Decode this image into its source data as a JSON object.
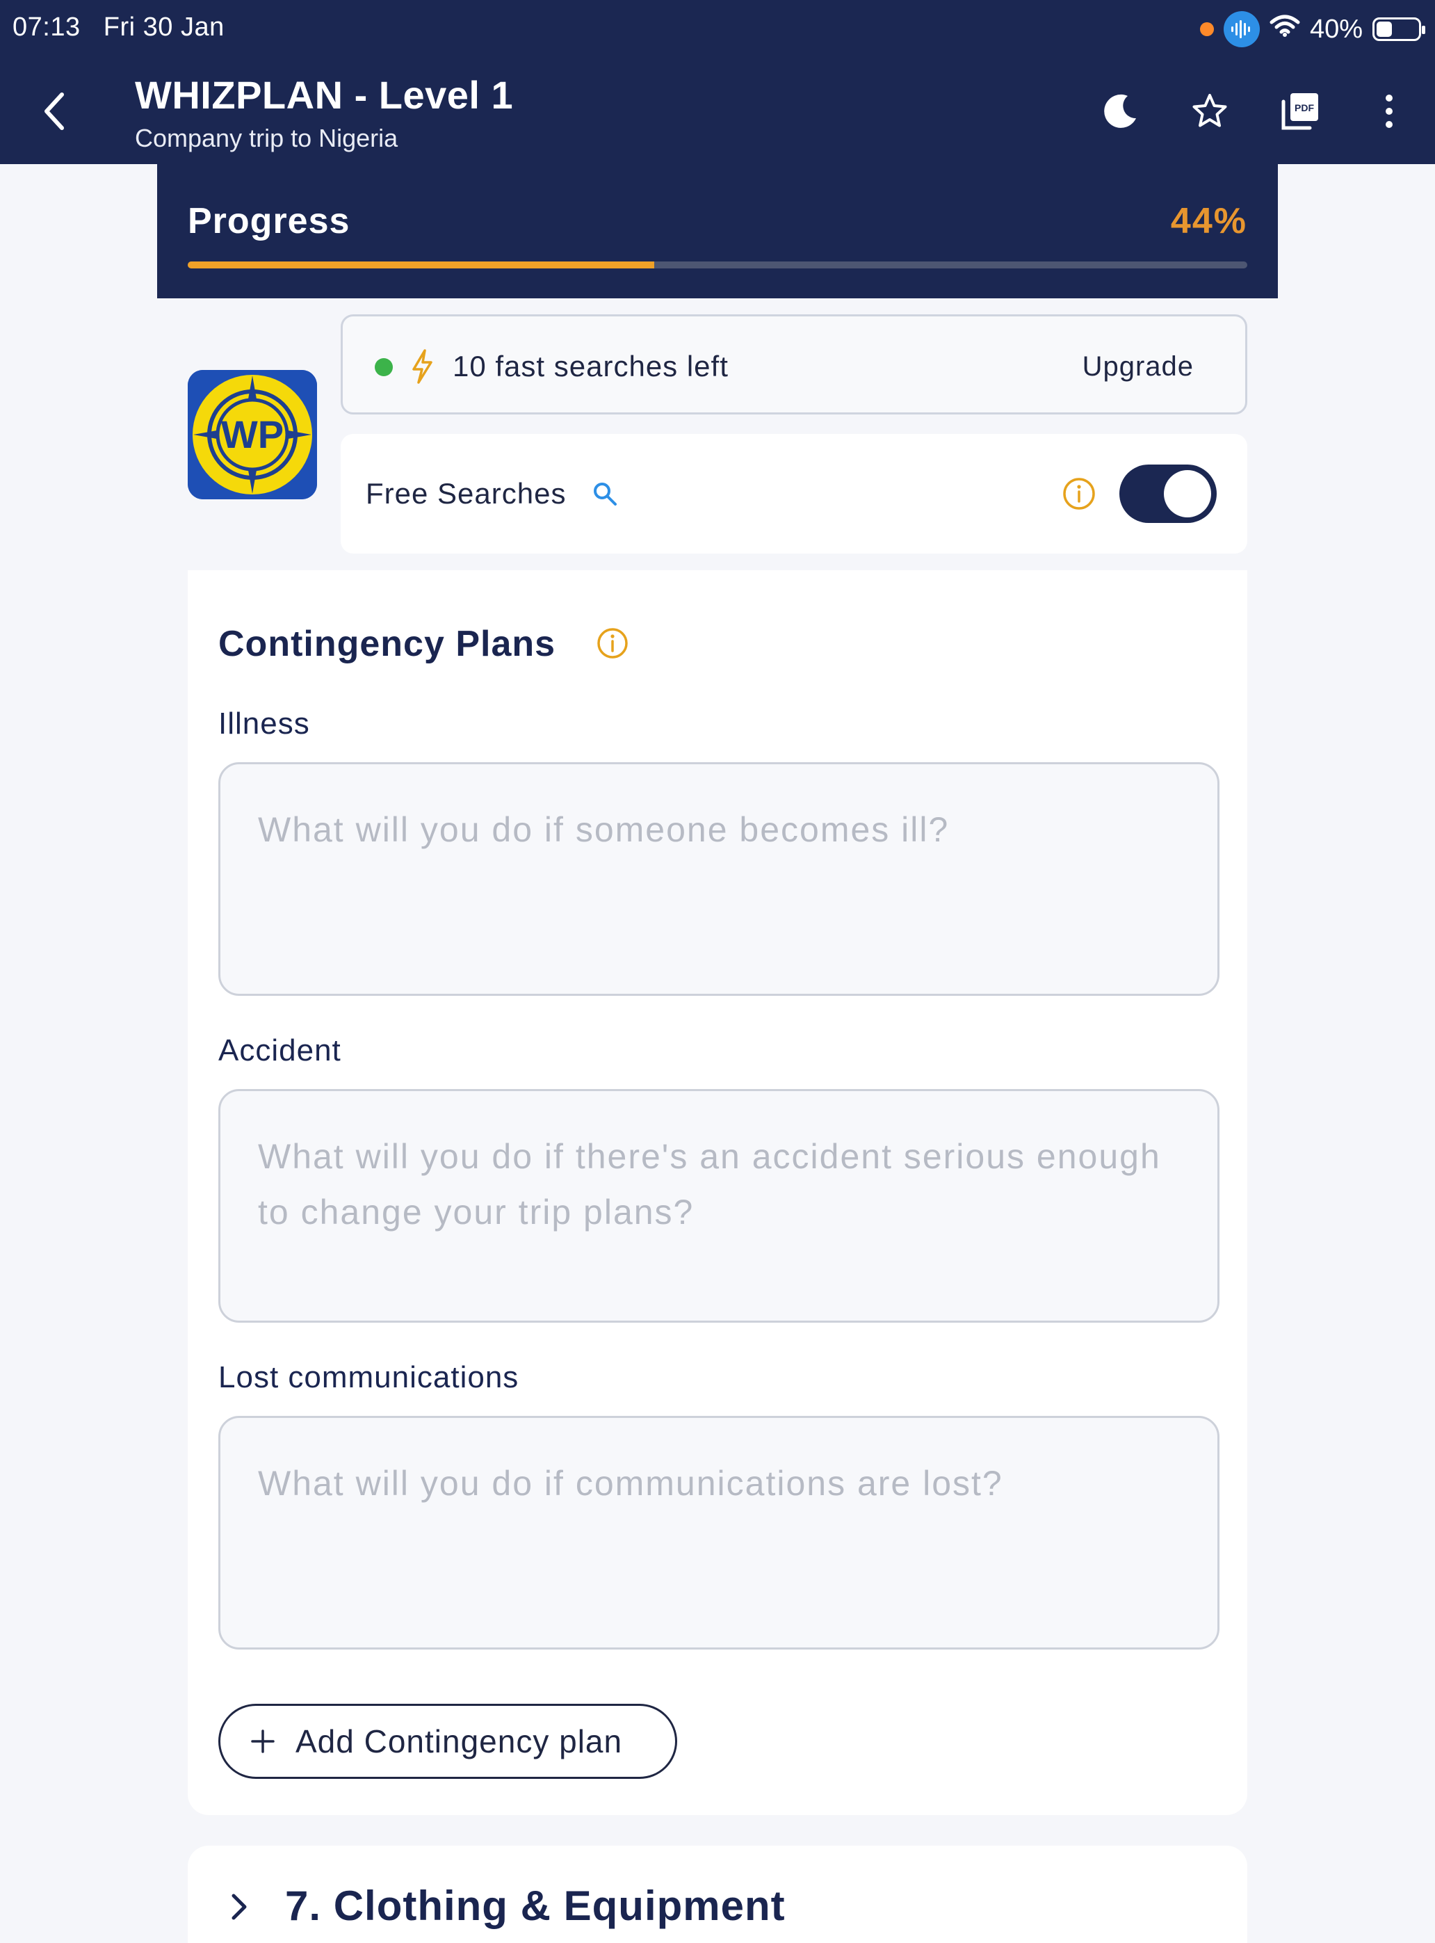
{
  "status_bar": {
    "time_date": "07:13   Fri 30 Jan",
    "battery": "40%",
    "icons": [
      "orange-dot",
      "audio-waveform-icon",
      "wifi-icon",
      "battery-icon"
    ]
  },
  "header": {
    "title": "WHIZPLAN - Level 1",
    "subtitle": "Company trip to Nigeria",
    "icons": [
      "back-chevron-icon",
      "moon-icon",
      "star-icon",
      "pdf-icon",
      "more-vertical-icon"
    ]
  },
  "progress": {
    "label": "Progress",
    "percent_text": "44%",
    "value": 0.44,
    "fill_color": "#f0a128",
    "bg_color": "#1b2752"
  },
  "searches": {
    "fast_left_text": "10 fast searches left",
    "upgrade_label": "Upgrade",
    "status_color": "#3cb34a",
    "free_label": "Free Searches",
    "free_enabled": true
  },
  "contingency": {
    "title": "Contingency Plans",
    "fields": [
      {
        "label": "Illness",
        "value": "",
        "placeholder": "What will you do if someone becomes ill?"
      },
      {
        "label": "Accident",
        "value": "",
        "placeholder": "What will you do if there's an accident serious enough to change your trip plans?"
      },
      {
        "label": "Lost communications",
        "value": "",
        "placeholder": "What will you do if communications are lost?"
      }
    ],
    "add_label": "Add Contingency plan"
  },
  "next_section": {
    "title": "7. Clothing & Equipment"
  },
  "colors": {
    "navy": "#1b2752",
    "accent_orange": "#e8962f",
    "info_yellow": "#e6a21c",
    "link_blue": "#2d8fe6"
  }
}
